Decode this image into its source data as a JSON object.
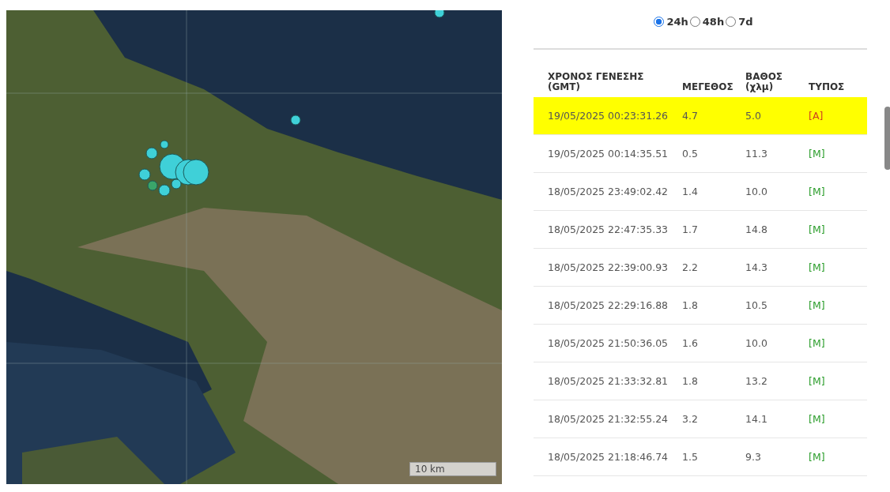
{
  "map": {
    "scale_label": "10 km"
  },
  "period_options": [
    {
      "label": "24h",
      "selected": true
    },
    {
      "label": "48h",
      "selected": false
    },
    {
      "label": "7d",
      "selected": false
    }
  ],
  "table": {
    "columns": [
      "ΧΡΟΝΟΣ ΓΕΝΕΣΗΣ (GMT)",
      "ΜΕΓΕΘΟΣ",
      "ΒΑΘΟΣ (χλμ)",
      "ΤΥΠΟΣ"
    ],
    "rows": [
      {
        "time": "19/05/2025 00:23:31.26",
        "magnitude": "4.7",
        "depth": "5.0",
        "type": "[A]",
        "kind": "automatic",
        "selected": true
      },
      {
        "time": "19/05/2025 00:14:35.51",
        "magnitude": "0.5",
        "depth": "11.3",
        "type": "[M]",
        "kind": "manual",
        "selected": false
      },
      {
        "time": "18/05/2025 23:49:02.42",
        "magnitude": "1.4",
        "depth": "10.0",
        "type": "[M]",
        "kind": "manual",
        "selected": false
      },
      {
        "time": "18/05/2025 22:47:35.33",
        "magnitude": "1.7",
        "depth": "14.8",
        "type": "[M]",
        "kind": "manual",
        "selected": false
      },
      {
        "time": "18/05/2025 22:39:00.93",
        "magnitude": "2.2",
        "depth": "14.3",
        "type": "[M]",
        "kind": "manual",
        "selected": false
      },
      {
        "time": "18/05/2025 22:29:16.88",
        "magnitude": "1.8",
        "depth": "10.5",
        "type": "[M]",
        "kind": "manual",
        "selected": false
      },
      {
        "time": "18/05/2025 21:50:36.05",
        "magnitude": "1.6",
        "depth": "10.0",
        "type": "[M]",
        "kind": "manual",
        "selected": false
      },
      {
        "time": "18/05/2025 21:33:32.81",
        "magnitude": "1.8",
        "depth": "13.2",
        "type": "[M]",
        "kind": "manual",
        "selected": false
      },
      {
        "time": "18/05/2025 21:32:55.24",
        "magnitude": "3.2",
        "depth": "14.1",
        "type": "[M]",
        "kind": "manual",
        "selected": false
      },
      {
        "time": "18/05/2025 21:18:46.74",
        "magnitude": "1.5",
        "depth": "9.3",
        "type": "[M]",
        "kind": "manual",
        "selected": false
      }
    ]
  }
}
